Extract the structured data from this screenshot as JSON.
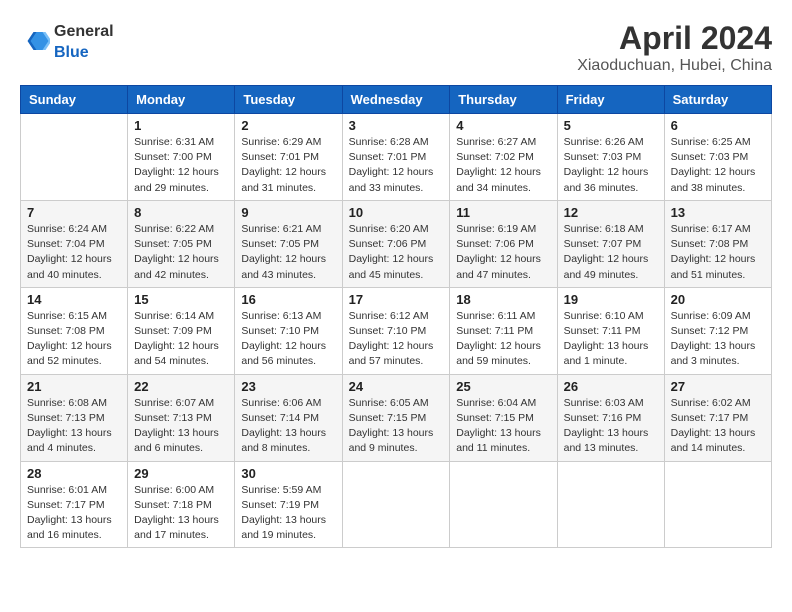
{
  "logo": {
    "general": "General",
    "blue": "Blue"
  },
  "title": "April 2024",
  "subtitle": "Xiaoduchuan, Hubei, China",
  "days_header": [
    "Sunday",
    "Monday",
    "Tuesday",
    "Wednesday",
    "Thursday",
    "Friday",
    "Saturday"
  ],
  "weeks": [
    [
      {
        "num": "",
        "info": ""
      },
      {
        "num": "1",
        "info": "Sunrise: 6:31 AM\nSunset: 7:00 PM\nDaylight: 12 hours\nand 29 minutes."
      },
      {
        "num": "2",
        "info": "Sunrise: 6:29 AM\nSunset: 7:01 PM\nDaylight: 12 hours\nand 31 minutes."
      },
      {
        "num": "3",
        "info": "Sunrise: 6:28 AM\nSunset: 7:01 PM\nDaylight: 12 hours\nand 33 minutes."
      },
      {
        "num": "4",
        "info": "Sunrise: 6:27 AM\nSunset: 7:02 PM\nDaylight: 12 hours\nand 34 minutes."
      },
      {
        "num": "5",
        "info": "Sunrise: 6:26 AM\nSunset: 7:03 PM\nDaylight: 12 hours\nand 36 minutes."
      },
      {
        "num": "6",
        "info": "Sunrise: 6:25 AM\nSunset: 7:03 PM\nDaylight: 12 hours\nand 38 minutes."
      }
    ],
    [
      {
        "num": "7",
        "info": "Sunrise: 6:24 AM\nSunset: 7:04 PM\nDaylight: 12 hours\nand 40 minutes."
      },
      {
        "num": "8",
        "info": "Sunrise: 6:22 AM\nSunset: 7:05 PM\nDaylight: 12 hours\nand 42 minutes."
      },
      {
        "num": "9",
        "info": "Sunrise: 6:21 AM\nSunset: 7:05 PM\nDaylight: 12 hours\nand 43 minutes."
      },
      {
        "num": "10",
        "info": "Sunrise: 6:20 AM\nSunset: 7:06 PM\nDaylight: 12 hours\nand 45 minutes."
      },
      {
        "num": "11",
        "info": "Sunrise: 6:19 AM\nSunset: 7:06 PM\nDaylight: 12 hours\nand 47 minutes."
      },
      {
        "num": "12",
        "info": "Sunrise: 6:18 AM\nSunset: 7:07 PM\nDaylight: 12 hours\nand 49 minutes."
      },
      {
        "num": "13",
        "info": "Sunrise: 6:17 AM\nSunset: 7:08 PM\nDaylight: 12 hours\nand 51 minutes."
      }
    ],
    [
      {
        "num": "14",
        "info": "Sunrise: 6:15 AM\nSunset: 7:08 PM\nDaylight: 12 hours\nand 52 minutes."
      },
      {
        "num": "15",
        "info": "Sunrise: 6:14 AM\nSunset: 7:09 PM\nDaylight: 12 hours\nand 54 minutes."
      },
      {
        "num": "16",
        "info": "Sunrise: 6:13 AM\nSunset: 7:10 PM\nDaylight: 12 hours\nand 56 minutes."
      },
      {
        "num": "17",
        "info": "Sunrise: 6:12 AM\nSunset: 7:10 PM\nDaylight: 12 hours\nand 57 minutes."
      },
      {
        "num": "18",
        "info": "Sunrise: 6:11 AM\nSunset: 7:11 PM\nDaylight: 12 hours\nand 59 minutes."
      },
      {
        "num": "19",
        "info": "Sunrise: 6:10 AM\nSunset: 7:11 PM\nDaylight: 13 hours\nand 1 minute."
      },
      {
        "num": "20",
        "info": "Sunrise: 6:09 AM\nSunset: 7:12 PM\nDaylight: 13 hours\nand 3 minutes."
      }
    ],
    [
      {
        "num": "21",
        "info": "Sunrise: 6:08 AM\nSunset: 7:13 PM\nDaylight: 13 hours\nand 4 minutes."
      },
      {
        "num": "22",
        "info": "Sunrise: 6:07 AM\nSunset: 7:13 PM\nDaylight: 13 hours\nand 6 minutes."
      },
      {
        "num": "23",
        "info": "Sunrise: 6:06 AM\nSunset: 7:14 PM\nDaylight: 13 hours\nand 8 minutes."
      },
      {
        "num": "24",
        "info": "Sunrise: 6:05 AM\nSunset: 7:15 PM\nDaylight: 13 hours\nand 9 minutes."
      },
      {
        "num": "25",
        "info": "Sunrise: 6:04 AM\nSunset: 7:15 PM\nDaylight: 13 hours\nand 11 minutes."
      },
      {
        "num": "26",
        "info": "Sunrise: 6:03 AM\nSunset: 7:16 PM\nDaylight: 13 hours\nand 13 minutes."
      },
      {
        "num": "27",
        "info": "Sunrise: 6:02 AM\nSunset: 7:17 PM\nDaylight: 13 hours\nand 14 minutes."
      }
    ],
    [
      {
        "num": "28",
        "info": "Sunrise: 6:01 AM\nSunset: 7:17 PM\nDaylight: 13 hours\nand 16 minutes."
      },
      {
        "num": "29",
        "info": "Sunrise: 6:00 AM\nSunset: 7:18 PM\nDaylight: 13 hours\nand 17 minutes."
      },
      {
        "num": "30",
        "info": "Sunrise: 5:59 AM\nSunset: 7:19 PM\nDaylight: 13 hours\nand 19 minutes."
      },
      {
        "num": "",
        "info": ""
      },
      {
        "num": "",
        "info": ""
      },
      {
        "num": "",
        "info": ""
      },
      {
        "num": "",
        "info": ""
      }
    ]
  ]
}
